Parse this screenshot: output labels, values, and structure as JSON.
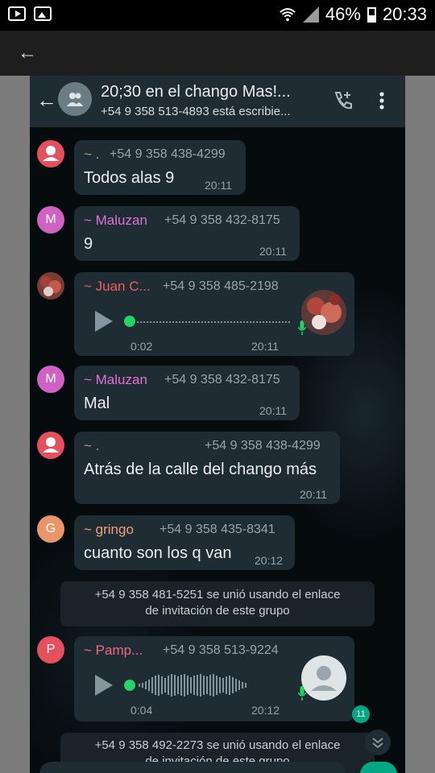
{
  "status_bar": {
    "battery": "46%",
    "time": "20:33"
  },
  "chat": {
    "title": "20;30 en el chango Mas!...",
    "subtitle": "+54 9 358 513-4893 está escribie..."
  },
  "messages": [
    {
      "sender": "~ .",
      "phone": "+54 9 358 438-4299",
      "text": "Todos alas 9",
      "time": "20:11",
      "avatar_color": "#e5505e",
      "sender_color": "#d78b8b"
    },
    {
      "sender": "~ Maluzan",
      "phone": "+54 9 358 432-8175",
      "text": "9",
      "time": "20:11",
      "avatar_letter": "M",
      "avatar_color": "#d062c4",
      "sender_color": "#e071d6"
    },
    {
      "sender": "~ Juan C...",
      "phone": "+54 9 358 485-2198",
      "voice_duration": "0:02",
      "time": "20:11",
      "sender_color": "#ef5f5f"
    },
    {
      "sender": "~ Maluzan",
      "phone": "+54 9 358 432-8175",
      "text": "Mal",
      "time": "20:11",
      "avatar_letter": "M",
      "avatar_color": "#d062c4",
      "sender_color": "#e071d6"
    },
    {
      "sender": "~ .",
      "phone": "+54 9 358 438-4299",
      "text": "Atrás de la calle del chango más",
      "time": "20:11",
      "avatar_color": "#e5505e",
      "sender_color": "#d78b8b"
    },
    {
      "sender": "~ gringo",
      "phone": "+54 9 358 435-8341",
      "text": "cuanto son los q van",
      "time": "20:12",
      "avatar_letter": "G",
      "avatar_color": "#e8956a",
      "sender_color": "#f0a17a"
    },
    {
      "sender": "~ Pamp...",
      "phone": "+54 9 358 513-9224",
      "voice_duration": "0:04",
      "time": "20:12",
      "avatar_letter": "P",
      "avatar_color": "#e5505e",
      "sender_color": "#ef6b7b"
    }
  ],
  "system_messages": [
    {
      "line1": "+54 9 358 481-5251 se unió usando el enlace",
      "line2": "de invitación de este grupo"
    },
    {
      "line1": "+54 9 358 492-2273 se unió usando el enlace",
      "line2": "de invitación de este grupo"
    }
  ],
  "unread_count": "11",
  "colors": {
    "accent_green": "#25d366",
    "bubble": "#1f2c33",
    "header": "#1f2c33"
  }
}
